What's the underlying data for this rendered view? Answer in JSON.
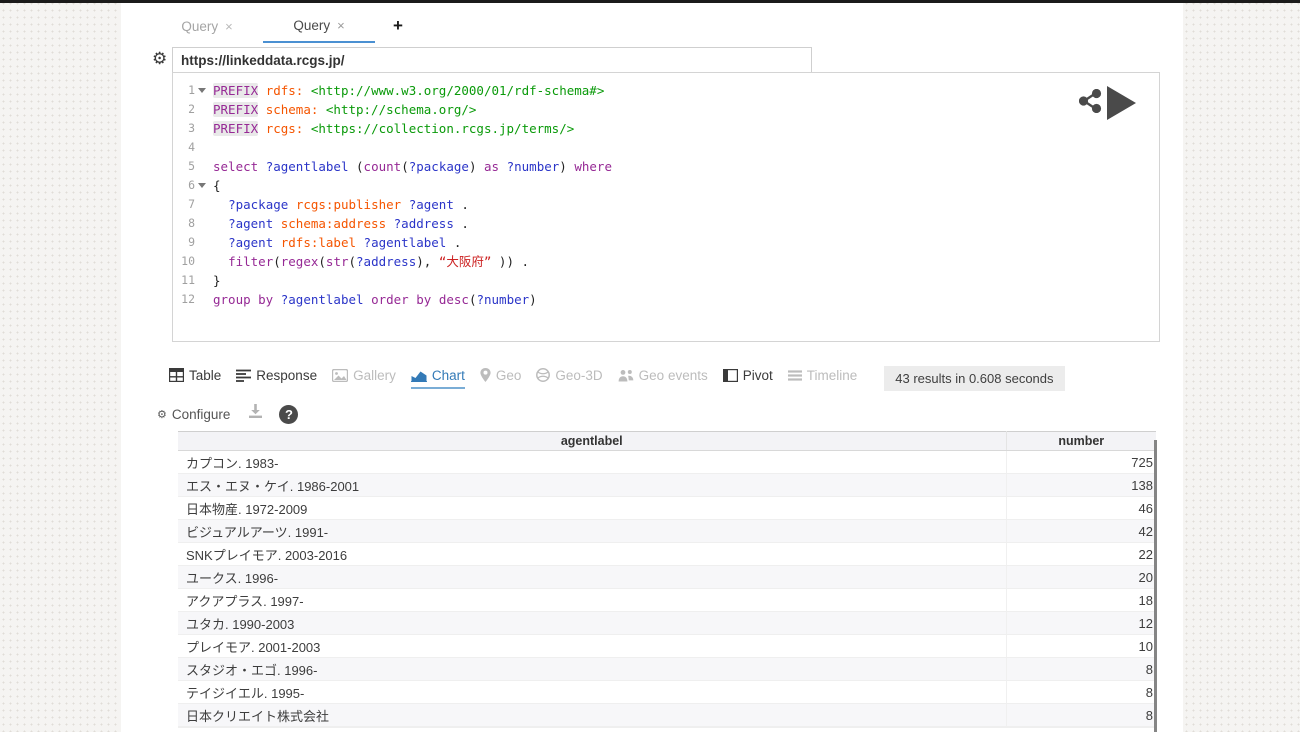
{
  "window": {
    "tabs": [
      {
        "label": "Query"
      },
      {
        "label": "Query"
      }
    ],
    "close_icon": "×",
    "new_tab_label": "+"
  },
  "endpoint": {
    "url": "https://linkeddata.rcgs.jp/"
  },
  "editor": {
    "lines": [
      {
        "n": 1,
        "fold": true,
        "tokens": [
          [
            "kwhl",
            "PREFIX"
          ],
          [
            "pl",
            " "
          ],
          [
            "pn",
            "rdfs:"
          ],
          [
            "pl",
            " "
          ],
          [
            "uri",
            "<http://www.w3.org/2000/01/rdf-schema#>"
          ]
        ]
      },
      {
        "n": 2,
        "fold": false,
        "tokens": [
          [
            "kwhl",
            "PREFIX"
          ],
          [
            "pl",
            " "
          ],
          [
            "pn",
            "schema:"
          ],
          [
            "pl",
            " "
          ],
          [
            "uri",
            "<http://schema.org/>"
          ]
        ]
      },
      {
        "n": 3,
        "fold": false,
        "tokens": [
          [
            "kwhl",
            "PREFIX"
          ],
          [
            "pl",
            " "
          ],
          [
            "pn",
            "rcgs:"
          ],
          [
            "pl",
            " "
          ],
          [
            "uri",
            "<https://collection.rcgs.jp/terms/>"
          ]
        ]
      },
      {
        "n": 4,
        "fold": false,
        "tokens": []
      },
      {
        "n": 5,
        "fold": false,
        "tokens": [
          [
            "kw",
            "select"
          ],
          [
            "pl",
            " "
          ],
          [
            "var",
            "?agentlabel"
          ],
          [
            "pl",
            " ("
          ],
          [
            "kw",
            "count"
          ],
          [
            "pl",
            "("
          ],
          [
            "var",
            "?package"
          ],
          [
            "pl",
            ") "
          ],
          [
            "kw",
            "as"
          ],
          [
            "pl",
            " "
          ],
          [
            "var",
            "?number"
          ],
          [
            "pl",
            ") "
          ],
          [
            "kw",
            "where"
          ]
        ]
      },
      {
        "n": 6,
        "fold": true,
        "tokens": [
          [
            "pl",
            "{"
          ]
        ]
      },
      {
        "n": 7,
        "fold": false,
        "tokens": [
          [
            "pl",
            "  "
          ],
          [
            "var",
            "?package"
          ],
          [
            "pl",
            " "
          ],
          [
            "pn",
            "rcgs:publisher"
          ],
          [
            "pl",
            " "
          ],
          [
            "var",
            "?agent"
          ],
          [
            "pl",
            " ."
          ]
        ]
      },
      {
        "n": 8,
        "fold": false,
        "tokens": [
          [
            "pl",
            "  "
          ],
          [
            "var",
            "?agent"
          ],
          [
            "pl",
            " "
          ],
          [
            "pn",
            "schema:address"
          ],
          [
            "pl",
            " "
          ],
          [
            "var",
            "?address"
          ],
          [
            "pl",
            " ."
          ]
        ]
      },
      {
        "n": 9,
        "fold": false,
        "tokens": [
          [
            "pl",
            "  "
          ],
          [
            "var",
            "?agent"
          ],
          [
            "pl",
            " "
          ],
          [
            "pn",
            "rdfs:label"
          ],
          [
            "pl",
            " "
          ],
          [
            "var",
            "?agentlabel"
          ],
          [
            "pl",
            " ."
          ]
        ]
      },
      {
        "n": 10,
        "fold": false,
        "tokens": [
          [
            "pl",
            "  "
          ],
          [
            "kw",
            "filter"
          ],
          [
            "pl",
            "("
          ],
          [
            "kw",
            "regex"
          ],
          [
            "pl",
            "("
          ],
          [
            "kw",
            "str"
          ],
          [
            "pl",
            "("
          ],
          [
            "var",
            "?address"
          ],
          [
            "pl",
            "), "
          ],
          [
            "str",
            "“大阪府”"
          ],
          [
            "pl",
            " )) ."
          ]
        ]
      },
      {
        "n": 11,
        "fold": false,
        "tokens": [
          [
            "pl",
            "}"
          ]
        ]
      },
      {
        "n": 12,
        "fold": false,
        "tokens": [
          [
            "kw",
            "group by"
          ],
          [
            "pl",
            " "
          ],
          [
            "var",
            "?agentlabel"
          ],
          [
            "pl",
            " "
          ],
          [
            "kw",
            "order by"
          ],
          [
            "pl",
            " "
          ],
          [
            "kw",
            "desc"
          ],
          [
            "pl",
            "("
          ],
          [
            "var",
            "?number"
          ],
          [
            "pl",
            ")"
          ]
        ]
      }
    ]
  },
  "actions": {
    "share_icon": "share-icon",
    "run_icon": "play-icon",
    "settings_icon": "gear-icon"
  },
  "result_tabs": [
    {
      "label": "Table",
      "icon": "table-icon",
      "state": "enabled"
    },
    {
      "label": "Response",
      "icon": "response-icon",
      "state": "enabled"
    },
    {
      "label": "Gallery",
      "icon": "gallery-icon",
      "state": "disabled"
    },
    {
      "label": "Chart",
      "icon": "chart-icon",
      "state": "active"
    },
    {
      "label": "Geo",
      "icon": "geo-pin-icon",
      "state": "disabled"
    },
    {
      "label": "Geo-3D",
      "icon": "globe-icon",
      "state": "disabled"
    },
    {
      "label": "Geo events",
      "icon": "people-icon",
      "state": "disabled"
    },
    {
      "label": "Pivot",
      "icon": "pivot-icon",
      "state": "enabled"
    },
    {
      "label": "Timeline",
      "icon": "timeline-icon",
      "state": "disabled"
    }
  ],
  "results_summary": "43 results in 0.608 seconds",
  "chart_toolbar": {
    "configure_label": "Configure",
    "gear_icon": "⚙",
    "download_icon": "download-icon",
    "help_glyph": "?"
  },
  "results_table": {
    "columns": [
      "agentlabel",
      "number"
    ],
    "rows": [
      [
        "カプコン. 1983-",
        725
      ],
      [
        "エス・エヌ・ケイ. 1986-2001",
        138
      ],
      [
        "日本物産. 1972-2009",
        46
      ],
      [
        "ビジュアルアーツ. 1991-",
        42
      ],
      [
        "SNKプレイモア. 2003-2016",
        22
      ],
      [
        "ユークス. 1996-",
        20
      ],
      [
        "アクアプラス. 1997-",
        18
      ],
      [
        "ユタカ. 1990-2003",
        12
      ],
      [
        "プレイモア. 2001-2003",
        10
      ],
      [
        "スタジオ・エゴ. 1996-",
        8
      ],
      [
        "テイジイエル. 1995-",
        8
      ],
      [
        "日本クリエイト株式会社",
        8
      ]
    ]
  },
  "colors": {
    "accent_blue": "#337ab7",
    "keyword": "#962995",
    "variable": "#2b35c8",
    "prefixed_name": "#f55500",
    "uri": "#0a9a0a",
    "string": "#cc2222"
  }
}
